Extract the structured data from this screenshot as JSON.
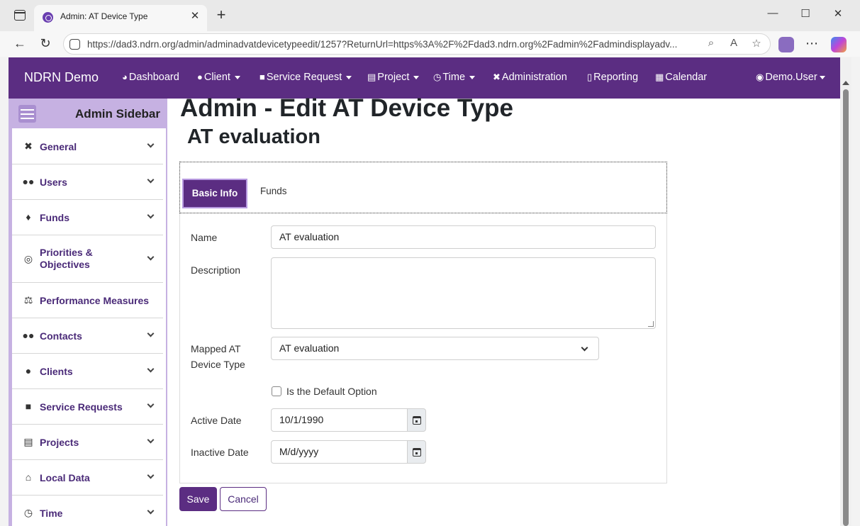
{
  "browser": {
    "tab_title": "Admin: AT Device Type",
    "url": "https://dad3.ndrn.org/admin/adminadvatdevicetypeedit/1257?ReturnUrl=https%3A%2F%2Fdad3.ndrn.org%2Fadmin%2Fadmindisplayadv..."
  },
  "app": {
    "brand": "NDRN Demo",
    "nav": [
      {
        "label": "Dashboard"
      },
      {
        "label": "Client"
      },
      {
        "label": "Service Request"
      },
      {
        "label": "Project"
      },
      {
        "label": "Time"
      },
      {
        "label": "Administration"
      },
      {
        "label": "Reporting"
      },
      {
        "label": "Calendar"
      }
    ],
    "user": "Demo.User"
  },
  "sidebar": {
    "title": "Admin Sidebar",
    "items": [
      {
        "label": "General",
        "icon": "tools-icon"
      },
      {
        "label": "Users",
        "icon": "users-icon"
      },
      {
        "label": "Funds",
        "icon": "money-bag-icon"
      },
      {
        "label": "Priorities & Objectives",
        "icon": "target-icon"
      },
      {
        "label": "Performance Measures",
        "icon": "scale-icon"
      },
      {
        "label": "Contacts",
        "icon": "users-icon"
      },
      {
        "label": "Clients",
        "icon": "user-icon"
      },
      {
        "label": "Service Requests",
        "icon": "briefcase-icon"
      },
      {
        "label": "Projects",
        "icon": "clipboard-icon"
      },
      {
        "label": "Local Data",
        "icon": "house-icon"
      },
      {
        "label": "Time",
        "icon": "clock-icon"
      }
    ]
  },
  "main": {
    "title": "Admin - Edit AT Device Type",
    "subtitle": "AT evaluation",
    "tabs": [
      {
        "label": "Basic Info",
        "active": true
      },
      {
        "label": "Funds",
        "active": false
      }
    ],
    "form": {
      "name_label": "Name",
      "name_value": "AT evaluation",
      "description_label": "Description",
      "description_value": "",
      "mapped_label_line1": "Mapped AT",
      "mapped_label_line2": "Device Type",
      "mapped_value": "AT evaluation",
      "default_label": "Is the Default Option",
      "default_checked": false,
      "active_date_label": "Active Date",
      "active_date_value": "10/1/1990",
      "inactive_date_label": "Inactive Date",
      "inactive_date_placeholder": "M/d/yyyy"
    },
    "buttons": {
      "save": "Save",
      "cancel": "Cancel"
    }
  },
  "colors": {
    "brand": "#5b2d82",
    "sidebar_bg": "#c6b1e2"
  }
}
